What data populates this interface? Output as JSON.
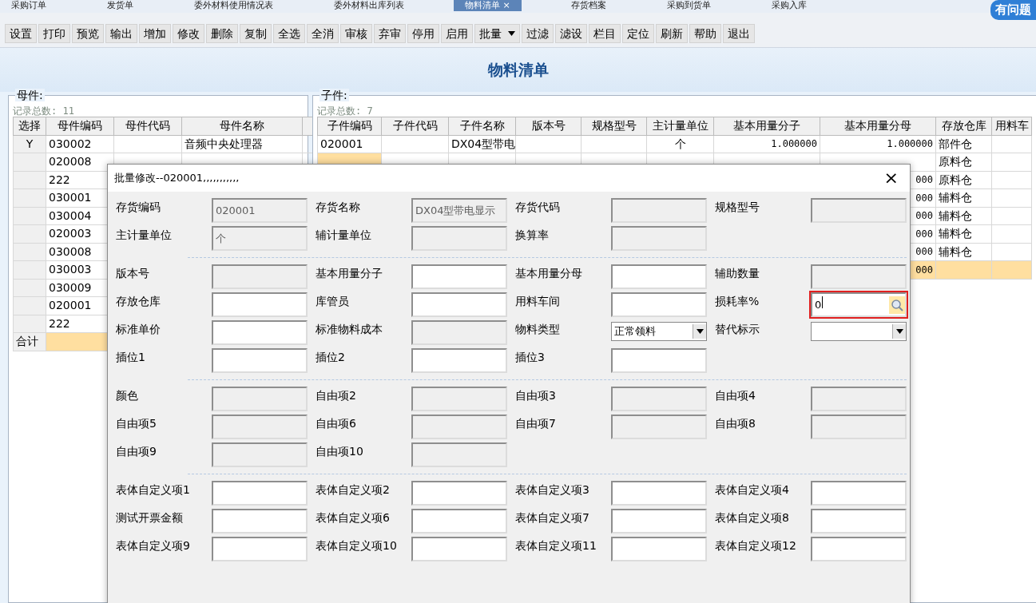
{
  "tabs": [
    {
      "label": "采购订单",
      "selected": false
    },
    {
      "label": "发货单",
      "selected": false
    },
    {
      "label": "委外材料使用情况表",
      "selected": false
    },
    {
      "label": "委外材料出库列表",
      "selected": false
    },
    {
      "label": "物料清单",
      "selected": true,
      "close": "×"
    },
    {
      "label": "存货档案",
      "selected": false
    },
    {
      "label": "采购到货单",
      "selected": false
    },
    {
      "label": "采购入库",
      "selected": false
    }
  ],
  "help_badge": "有问题",
  "toolbar": [
    {
      "label": "设置"
    },
    {
      "label": "打印"
    },
    {
      "label": "预览"
    },
    {
      "label": "输出"
    },
    {
      "label": "增加"
    },
    {
      "label": "修改"
    },
    {
      "label": "删除"
    },
    {
      "label": "复制"
    },
    {
      "label": "全选"
    },
    {
      "label": "全消"
    },
    {
      "label": "审核"
    },
    {
      "label": "弃审"
    },
    {
      "label": "停用"
    },
    {
      "label": "启用"
    },
    {
      "label": "批量",
      "kind": "dropdown"
    },
    {
      "label": "过滤"
    },
    {
      "label": "滤设"
    },
    {
      "label": "栏目"
    },
    {
      "label": "定位"
    },
    {
      "label": "刷新"
    },
    {
      "label": "帮助"
    },
    {
      "label": "退出"
    }
  ],
  "page_title": "物料清单",
  "parent_panel": {
    "legend": "母件:",
    "count": "记录总数: 11",
    "columns": [
      "选择",
      "母件编码",
      "母件代码",
      "母件名称"
    ],
    "rows": [
      {
        "cells": [
          "Y",
          "030002",
          "",
          "音频中央处理器"
        ]
      },
      {
        "cells": [
          "",
          "020008",
          "",
          ""
        ]
      },
      {
        "cells": [
          "",
          "222",
          "",
          ""
        ]
      },
      {
        "cells": [
          "",
          "030001",
          "",
          ""
        ]
      },
      {
        "cells": [
          "",
          "030004",
          "",
          ""
        ]
      },
      {
        "cells": [
          "",
          "020003",
          "",
          ""
        ]
      },
      {
        "cells": [
          "",
          "030008",
          "",
          ""
        ]
      },
      {
        "cells": [
          "",
          "030003",
          "",
          ""
        ]
      },
      {
        "cells": [
          "",
          "030009",
          "",
          ""
        ]
      },
      {
        "cells": [
          "",
          "020001",
          "",
          ""
        ]
      },
      {
        "cells": [
          "",
          "222",
          "",
          ""
        ]
      }
    ],
    "total_label": "合计"
  },
  "child_panel": {
    "legend": "子件:",
    "count": "记录总数: 7",
    "columns": [
      "子件编码",
      "子件代码",
      "子件名称",
      "版本号",
      "规格型号",
      "主计量单位",
      "基本用量分子",
      "基本用量分母",
      "存放仓库",
      "用料车"
    ],
    "rows": [
      {
        "cells": [
          "020001",
          "",
          "DX04型带电",
          "",
          "",
          "个",
          "1.000000",
          "1.000000",
          "部件仓",
          ""
        ]
      },
      {
        "cells": [
          "",
          "",
          "",
          "",
          "",
          "",
          "",
          "",
          "原料仓",
          ""
        ]
      },
      {
        "cells": [
          "",
          "",
          "",
          "",
          "",
          "",
          "",
          "000",
          "原料仓",
          ""
        ]
      },
      {
        "cells": [
          "",
          "",
          "",
          "",
          "",
          "",
          "",
          "000",
          "辅料仓",
          ""
        ]
      },
      {
        "cells": [
          "",
          "",
          "",
          "",
          "",
          "",
          "",
          "000",
          "辅料仓",
          ""
        ]
      },
      {
        "cells": [
          "",
          "",
          "",
          "",
          "",
          "",
          "",
          "000",
          "辅料仓",
          ""
        ]
      },
      {
        "cells": [
          "",
          "",
          "",
          "",
          "",
          "",
          "",
          "000",
          "辅料仓",
          ""
        ]
      }
    ],
    "total_cells": [
      "",
      "",
      "",
      "",
      "",
      "",
      "",
      "000",
      "",
      ""
    ]
  },
  "dialog": {
    "title": "批量修改--020001,,,,,,,,,,,",
    "close": "×",
    "sections": [
      {
        "fields": [
          {
            "label": "存货编码",
            "kind": "disabled",
            "value": "020001"
          },
          {
            "label": "存货名称",
            "kind": "disabled",
            "value": "DX04型带电显示"
          },
          {
            "label": "存货代码",
            "kind": "disabled"
          },
          {
            "label": "规格型号",
            "kind": "disabled"
          },
          {
            "label": "主计量单位",
            "kind": "disabled",
            "value": "个"
          },
          {
            "label": "辅计量单位",
            "kind": "disabled"
          },
          {
            "label": "换算率",
            "kind": "disabled"
          }
        ]
      },
      {
        "fields": [
          {
            "label": "版本号",
            "kind": "disabled"
          },
          {
            "label": "基本用量分子",
            "kind": "text"
          },
          {
            "label": "基本用量分母",
            "kind": "text"
          },
          {
            "label": "辅助数量",
            "kind": "disabled"
          },
          {
            "label": "存放仓库",
            "kind": "text"
          },
          {
            "label": "库管员",
            "kind": "text"
          },
          {
            "label": "用料车间",
            "kind": "text"
          },
          {
            "label": "损耗率%",
            "kind": "lookup",
            "value": "0",
            "highlighted": true
          },
          {
            "label": "标准单价",
            "kind": "text"
          },
          {
            "label": "标准物料成本",
            "kind": "disabled"
          },
          {
            "label": "物料类型",
            "kind": "select",
            "value": "正常领料"
          },
          {
            "label": "替代标示",
            "kind": "select"
          },
          {
            "label": "插位1",
            "kind": "text"
          },
          {
            "label": "插位2",
            "kind": "text"
          },
          {
            "label": "插位3",
            "kind": "text"
          }
        ]
      },
      {
        "fields": [
          {
            "label": "颜色",
            "kind": "disabled"
          },
          {
            "label": "自由项2",
            "kind": "disabled"
          },
          {
            "label": "自由项3",
            "kind": "disabled"
          },
          {
            "label": "自由项4",
            "kind": "disabled"
          },
          {
            "label": "自由项5",
            "kind": "disabled"
          },
          {
            "label": "自由项6",
            "kind": "disabled"
          },
          {
            "label": "自由项7",
            "kind": "disabled"
          },
          {
            "label": "自由项8",
            "kind": "disabled"
          },
          {
            "label": "自由项9",
            "kind": "disabled"
          },
          {
            "label": "自由项10",
            "kind": "disabled"
          }
        ]
      },
      {
        "fields": [
          {
            "label": "表体自定义项1",
            "kind": "text"
          },
          {
            "label": "表体自定义项2",
            "kind": "text"
          },
          {
            "label": "表体自定义项3",
            "kind": "text"
          },
          {
            "label": "表体自定义项4",
            "kind": "text"
          },
          {
            "label": "测试开票金额",
            "kind": "text"
          },
          {
            "label": "表体自定义项6",
            "kind": "text"
          },
          {
            "label": "表体自定义项7",
            "kind": "text"
          },
          {
            "label": "表体自定义项8",
            "kind": "text"
          },
          {
            "label": "表体自定义项9",
            "kind": "text"
          },
          {
            "label": "表体自定义项10",
            "kind": "text"
          },
          {
            "label": "表体自定义项11",
            "kind": "text"
          },
          {
            "label": "表体自定义项12",
            "kind": "text"
          }
        ]
      }
    ]
  }
}
